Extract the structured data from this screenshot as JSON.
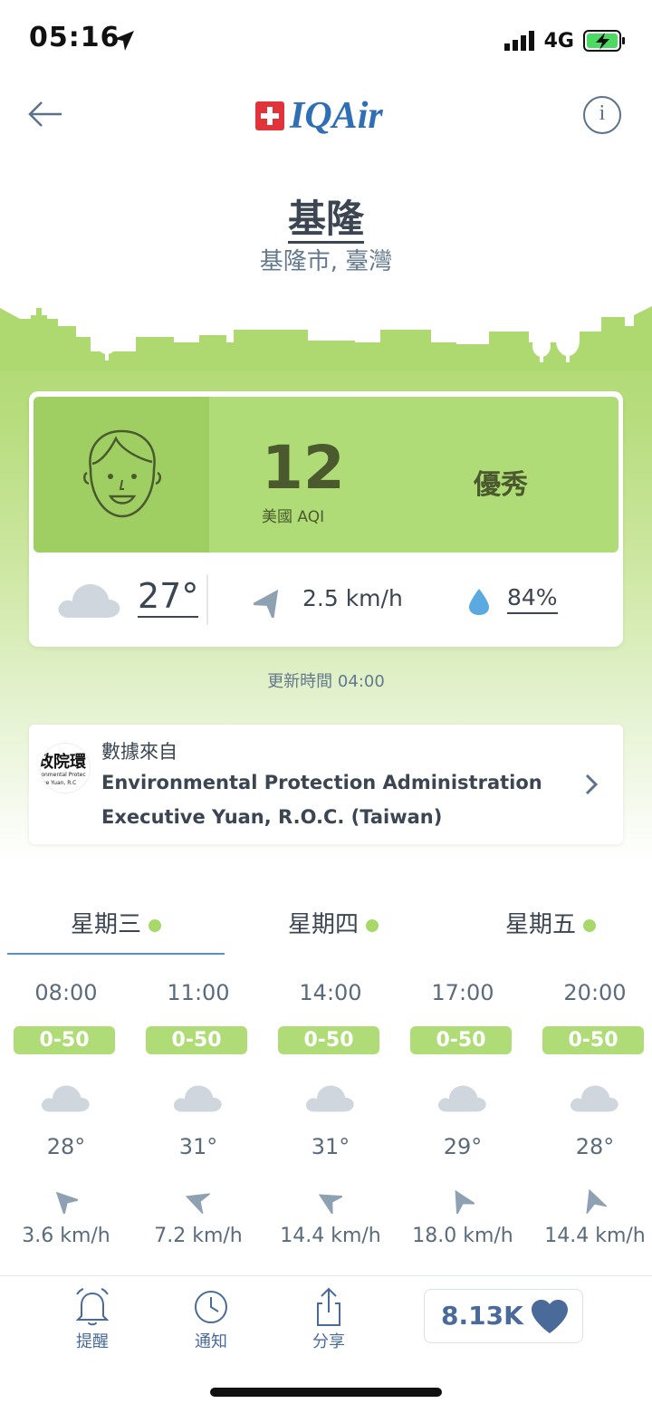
{
  "status_bar": {
    "time": "05:16",
    "network": "4G"
  },
  "header": {
    "brand": "IQAir"
  },
  "location": {
    "city": "基隆",
    "subtitle": "基隆市, 臺灣"
  },
  "aqi": {
    "value": "12",
    "label": "美國 AQI",
    "status": "優秀",
    "color": "#b0dc77"
  },
  "current_weather": {
    "temperature": "27°",
    "wind": "2.5 km/h",
    "humidity": "84%"
  },
  "updated": "更新時間 04:00",
  "source": {
    "label": "數據來自",
    "name_line1": "Environmental Protection Administration",
    "name_line2": "Executive Yuan, R.O.C. (Taiwan)",
    "logo_text_big": "政院環",
    "logo_text_small": "ronmental Protec\ntive Yuan, R.C"
  },
  "day_tabs": [
    {
      "label": "星期三",
      "selected": true
    },
    {
      "label": "星期四",
      "selected": false
    },
    {
      "label": "星期五",
      "selected": false
    }
  ],
  "forecast": [
    {
      "time": "08:00",
      "aqi": "0-50",
      "temp": "28°",
      "wind": "3.6 km/h"
    },
    {
      "time": "11:00",
      "aqi": "0-50",
      "temp": "31°",
      "wind": "7.2 km/h"
    },
    {
      "time": "14:00",
      "aqi": "0-50",
      "temp": "31°",
      "wind": "14.4 km/h"
    },
    {
      "time": "17:00",
      "aqi": "0-50",
      "temp": "29°",
      "wind": "18.0 km/h"
    },
    {
      "time": "20:00",
      "aqi": "0-50",
      "temp": "28°",
      "wind": "14.4 km/h"
    }
  ],
  "bottom_bar": {
    "reminder": "提醒",
    "notifications": "通知",
    "share": "分享",
    "likes": "8.13K"
  },
  "icons": {
    "back": "arrow-left-icon",
    "info": "info-icon",
    "cloud": "cloud-icon",
    "wind": "wind-direction-icon",
    "humidity": "water-drop-icon",
    "bell": "bell-icon",
    "clock": "clock-icon",
    "share": "share-icon",
    "heart": "heart-icon"
  }
}
